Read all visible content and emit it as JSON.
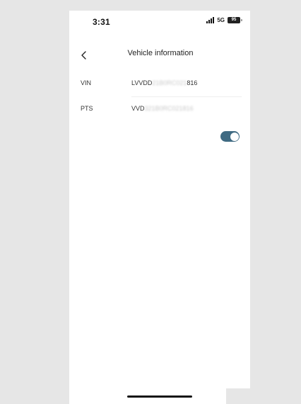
{
  "status_bar": {
    "time": "3:31",
    "network": "5G",
    "battery": "95"
  },
  "nav": {
    "back_icon": "chevron-left-icon",
    "title": "Vehicle information"
  },
  "rows": [
    {
      "label": "VIN",
      "value_prefix": "LVVDD",
      "value_redacted": "21B0RC021",
      "value_suffix": "816"
    },
    {
      "label": "PTS",
      "value_prefix": "VVD",
      "value_redacted": "321B0RC021816",
      "value_suffix": ""
    }
  ],
  "toggle": {
    "state": "on",
    "color": "#3f6a82"
  }
}
